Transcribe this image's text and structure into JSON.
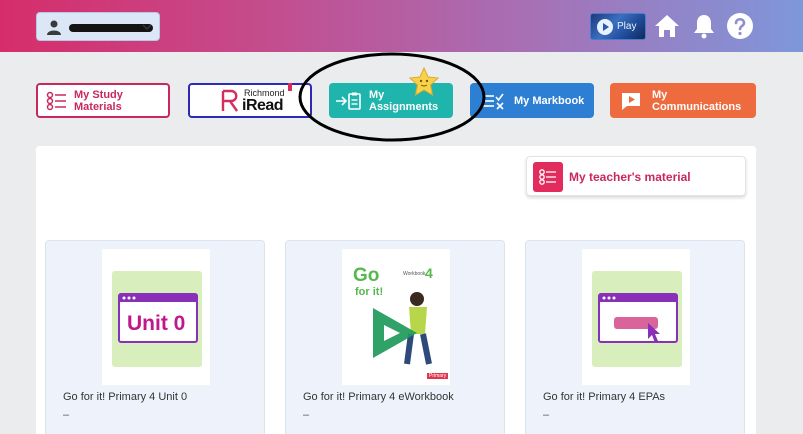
{
  "header": {
    "play_label": "Play",
    "colors": {
      "gradient_start": "#d62d6a",
      "gradient_end": "#7e97da"
    },
    "icons": [
      "user-icon",
      "chevron-down-icon",
      "play-icon",
      "home-icon",
      "bell-icon",
      "help-icon"
    ]
  },
  "nav": {
    "study_materials": "My Study Materials",
    "iread_brand_small": "Richmond",
    "iread_brand_big": "iRead",
    "assignments": "My Assignments",
    "markbook": "My Markbook",
    "communications": "My Communications"
  },
  "panel": {
    "teacher_material": "My teacher's material"
  },
  "cards": [
    {
      "title": "Go for it! Primary 4 Unit 0",
      "subtitle": "–",
      "thumb_text": "Unit 0"
    },
    {
      "title": "Go for it! Primary 4 eWorkbook",
      "subtitle": "–",
      "cover_go": "Go",
      "cover_forit": "for it!",
      "cover_workbook": "Workbook",
      "cover_level": "4",
      "cover_badge": "Primary"
    },
    {
      "title": "Go for it! Primary 4 EPAs",
      "subtitle": "–"
    }
  ]
}
